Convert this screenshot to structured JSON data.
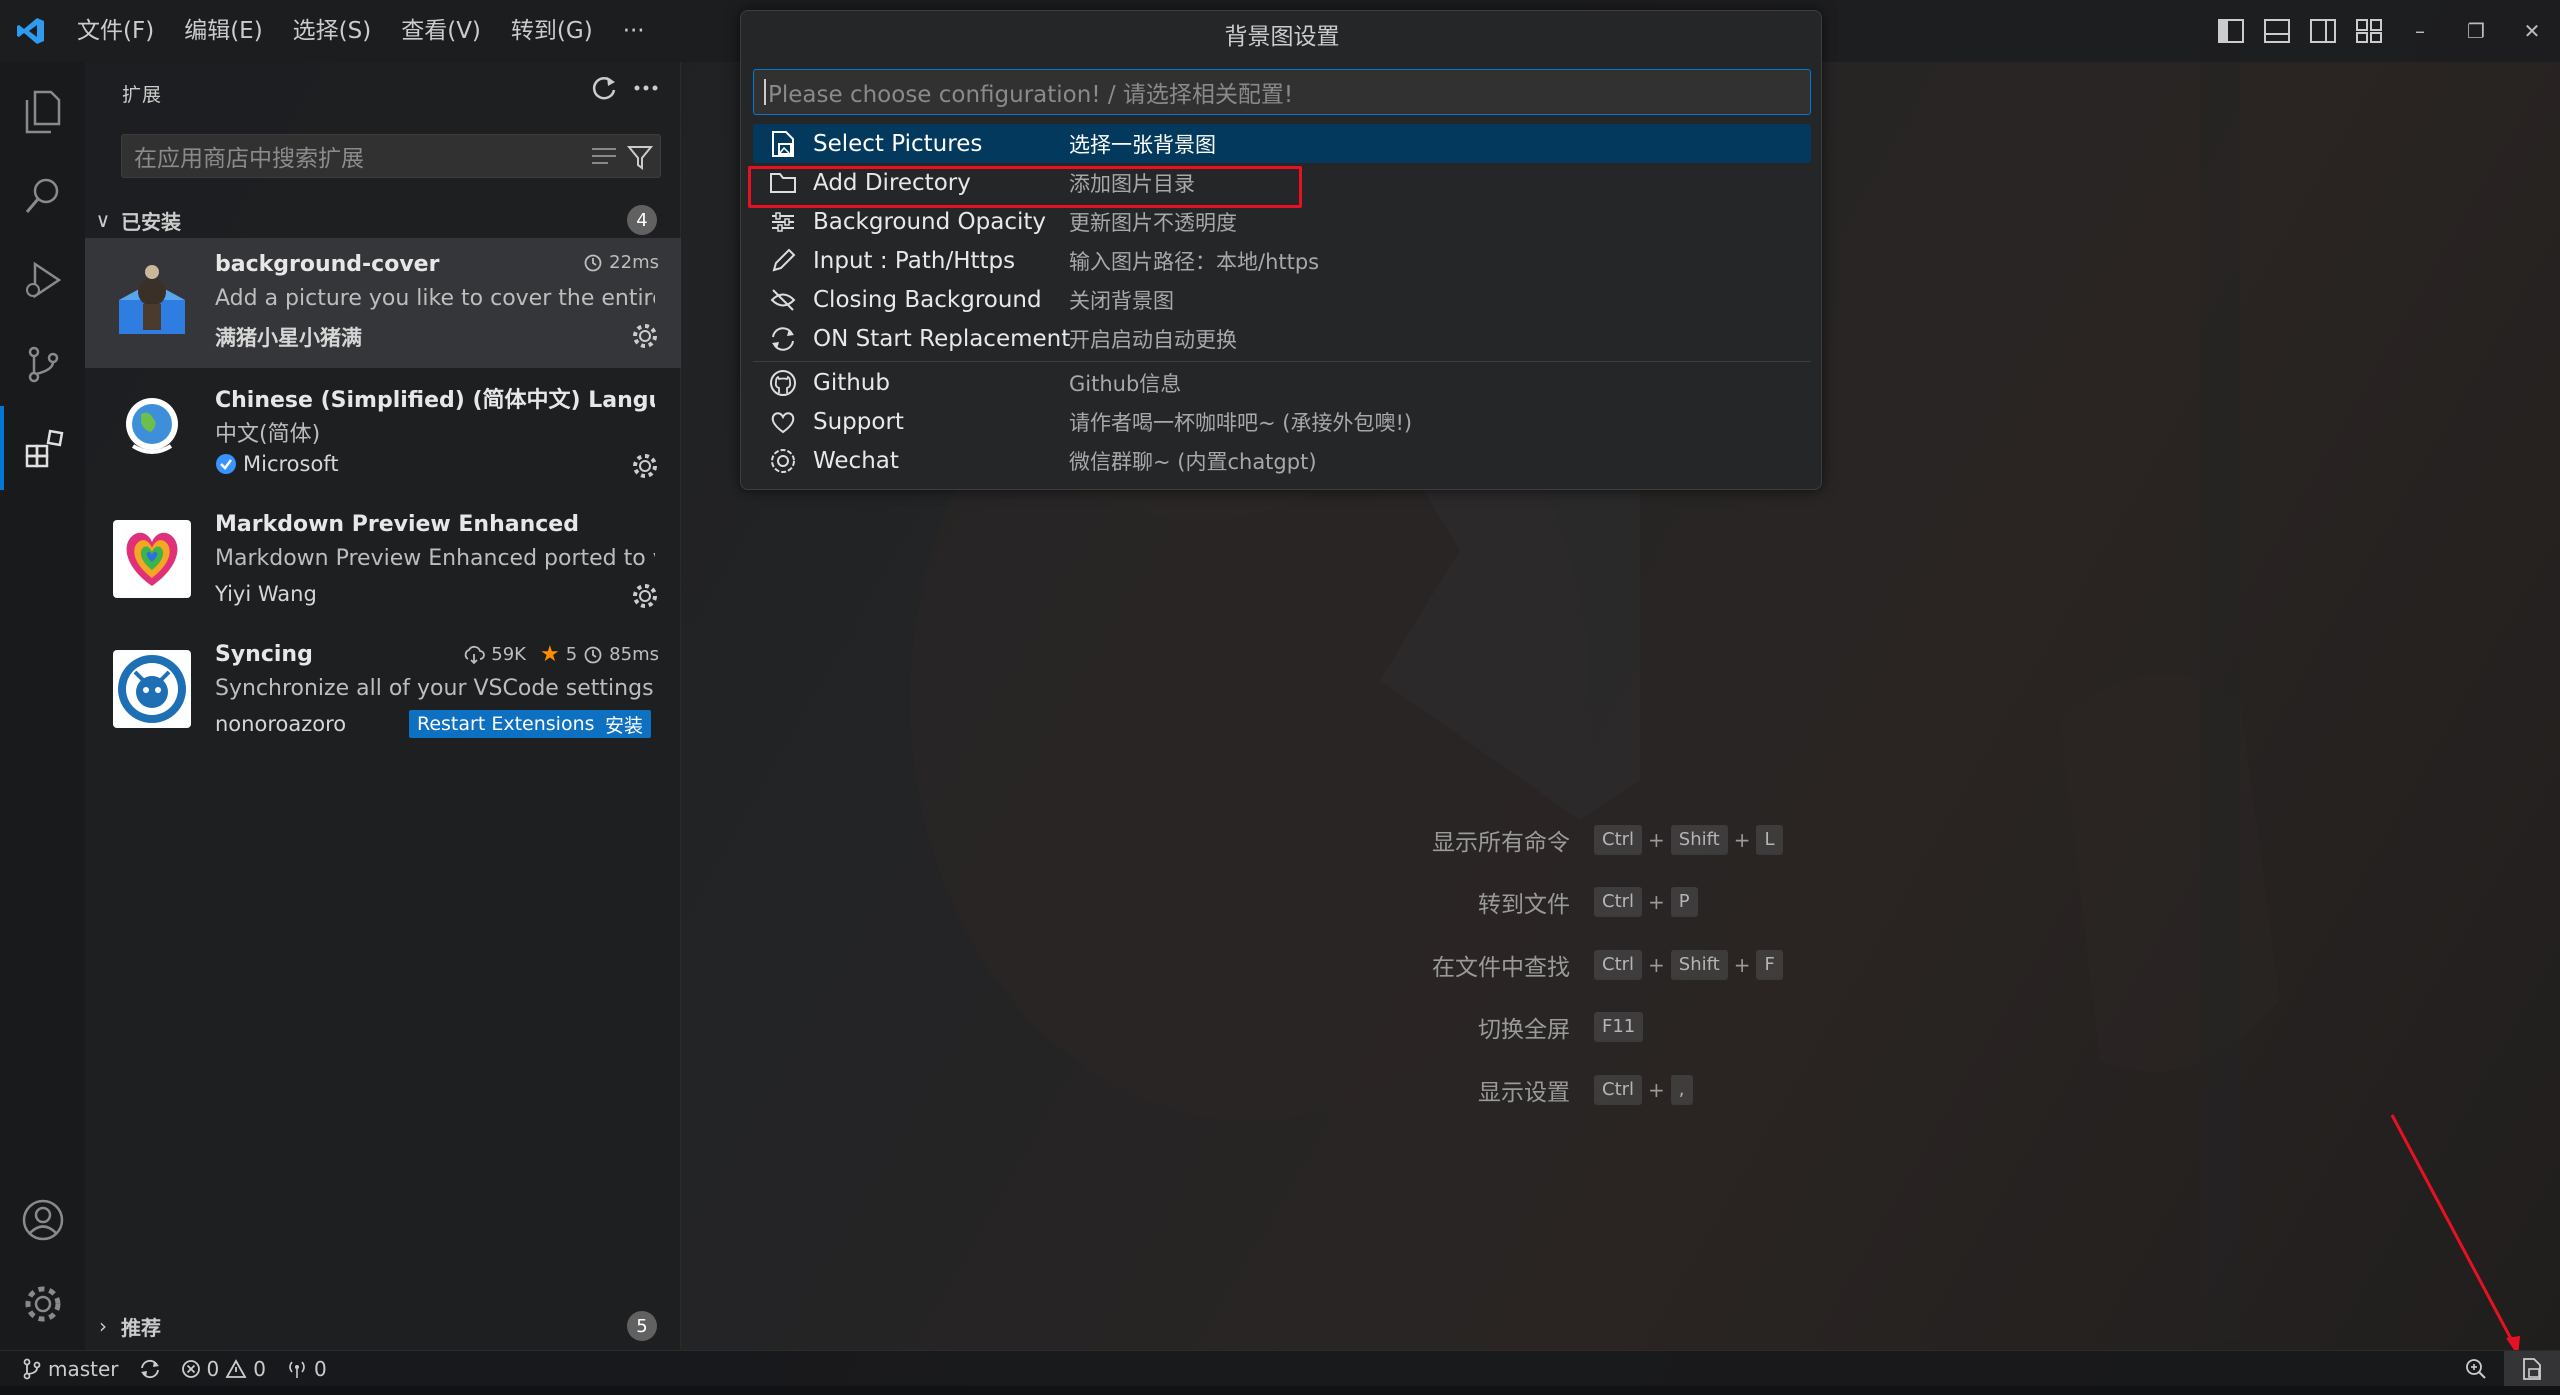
{
  "titlebar": {
    "menus": [
      "文件(F)",
      "编辑(E)",
      "选择(S)",
      "查看(V)",
      "转到(G)"
    ],
    "more": "···"
  },
  "sidebar": {
    "title": "扩展",
    "search_placeholder": "在应用商店中搜索扩展",
    "installed_label": "已安装",
    "installed_count": "4",
    "recommended_label": "推荐",
    "recommended_count": "5",
    "extensions": [
      {
        "name": "background-cover",
        "description": "Add a picture you like to cover the entire...",
        "publisher": "满猪小星小猪满",
        "time": "22ms"
      },
      {
        "name": "Chinese (Simplified) (简体中文) Langu...",
        "description": "中文(简体)",
        "publisher": "Microsoft"
      },
      {
        "name": "Markdown Preview Enhanced",
        "description": "Markdown Preview Enhanced ported to v...",
        "publisher": "Yiyi Wang"
      },
      {
        "name": "Syncing",
        "description": "Synchronize all of your VSCode settings a...",
        "publisher": "nonoroazoro",
        "downloads": "59K",
        "rating": "5",
        "time": "85ms",
        "restart_label": "Restart Extensions",
        "install_label": "安装"
      }
    ]
  },
  "quickpick": {
    "title": "背景图设置",
    "placeholder": "Please choose configuration! / 请选择相关配置!",
    "items": [
      {
        "label": "Select Pictures",
        "detail": "选择一张背景图",
        "icon": "file-image-icon"
      },
      {
        "label": "Add Directory",
        "detail": "添加图片目录",
        "icon": "folder-icon"
      },
      {
        "label": "Background Opacity",
        "detail": "更新图片不透明度",
        "icon": "settings-sliders-icon"
      },
      {
        "label": "Input : Path/Https",
        "detail": "输入图片路径：本地/https",
        "icon": "edit-icon"
      },
      {
        "label": "Closing Background",
        "detail": "关闭背景图",
        "icon": "eye-closed-icon"
      },
      {
        "label": "ON Start Replacement",
        "detail": "开启启动自动更换",
        "icon": "sync-icon"
      },
      {
        "label": "Github",
        "detail": "Github信息",
        "icon": "github-icon"
      },
      {
        "label": "Support",
        "detail": "请作者喝一杯咖啡吧~ (承接外包噢!)",
        "icon": "heart-icon"
      },
      {
        "label": "Wechat",
        "detail": "微信群聊~ (内置chatgpt)",
        "icon": "wechat-icon"
      }
    ]
  },
  "shortcuts": [
    {
      "label": "显示所有命令",
      "keys": [
        "Ctrl",
        "Shift",
        "L"
      ]
    },
    {
      "label": "转到文件",
      "keys": [
        "Ctrl",
        "P"
      ]
    },
    {
      "label": "在文件中查找",
      "keys": [
        "Ctrl",
        "Shift",
        "F"
      ]
    },
    {
      "label": "切换全屏",
      "keys": [
        "F11"
      ]
    },
    {
      "label": "显示设置",
      "keys": [
        "Ctrl",
        ","
      ]
    }
  ],
  "statusbar": {
    "branch": "master",
    "errors": "0",
    "warnings": "0",
    "ports": "0"
  },
  "colors": {
    "accent": "#0078d4",
    "highlight_box": "#e81123",
    "selected_item": "#04395e",
    "button": "#0e70c0"
  }
}
